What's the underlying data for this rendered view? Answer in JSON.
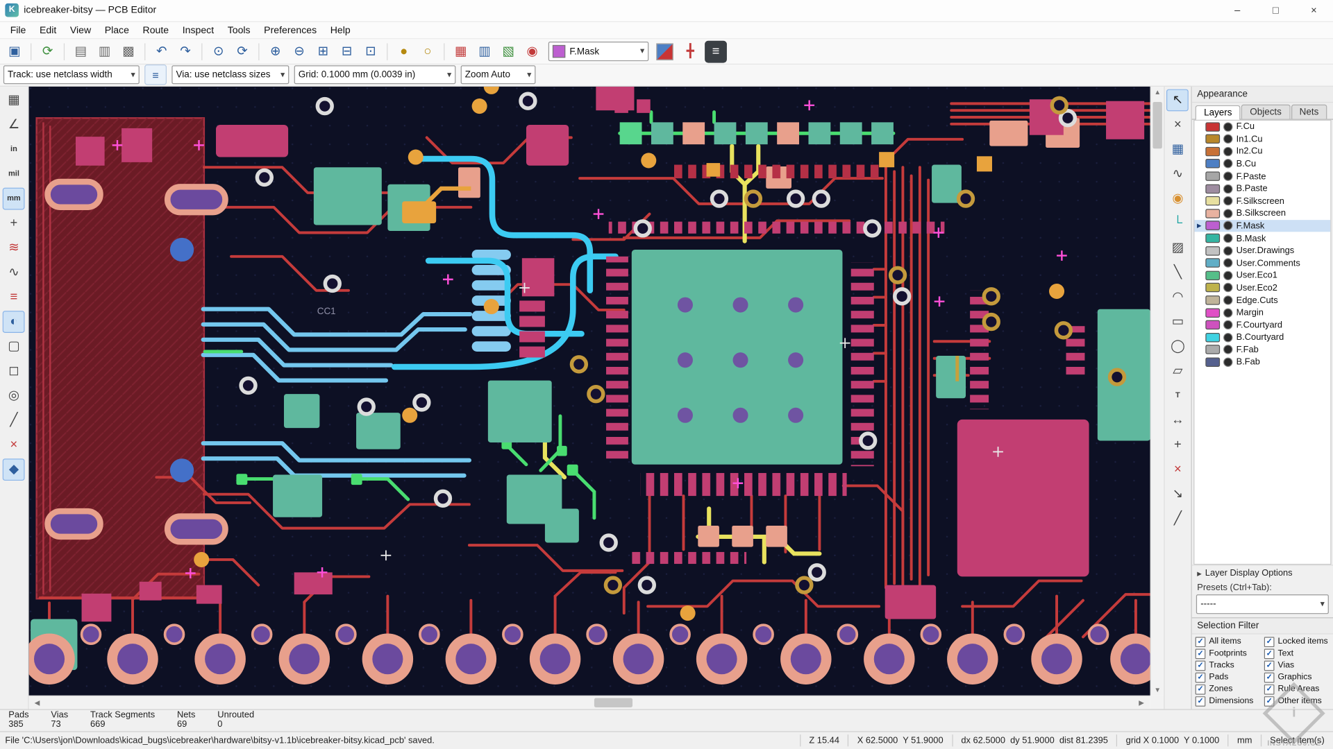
{
  "window": {
    "title": "icebreaker-bitsy — PCB Editor",
    "controls": [
      "–",
      "□",
      "×"
    ]
  },
  "menu_bar": {
    "items": [
      "File",
      "Edit",
      "View",
      "Place",
      "Route",
      "Inspect",
      "Tools",
      "Preferences",
      "Help"
    ]
  },
  "toolbar_main": {
    "icons": [
      {
        "name": "save-icon",
        "glyph": "▣",
        "color": "#2E5F9E"
      },
      {
        "sep": true
      },
      {
        "name": "plugin-refresh-icon",
        "glyph": "⟳",
        "color": "#3D8F3D"
      },
      {
        "sep": true
      },
      {
        "name": "page-settings-icon",
        "glyph": "▤",
        "color": "#666666"
      },
      {
        "name": "print-icon",
        "glyph": "▥",
        "color": "#666666"
      },
      {
        "name": "plot-icon",
        "glyph": "▩",
        "color": "#666666"
      },
      {
        "sep": true
      },
      {
        "name": "undo-icon",
        "glyph": "↶",
        "color": "#2E5F9E"
      },
      {
        "name": "redo-icon",
        "glyph": "↷",
        "color": "#2E5F9E"
      },
      {
        "sep": true
      },
      {
        "name": "find-icon",
        "glyph": "⊙",
        "color": "#2E5F9E"
      },
      {
        "name": "refresh-view-icon",
        "glyph": "⟳",
        "color": "#2E5F9E"
      },
      {
        "sep": true
      },
      {
        "name": "zoom-in-icon",
        "glyph": "⊕",
        "color": "#2E5F9E"
      },
      {
        "name": "zoom-out-icon",
        "glyph": "⊖",
        "color": "#2E5F9E"
      },
      {
        "name": "zoom-fit-icon",
        "glyph": "⊞",
        "color": "#2E5F9E"
      },
      {
        "name": "zoom-fit-objects-icon",
        "glyph": "⊟",
        "color": "#2E5F9E"
      },
      {
        "name": "zoom-selection-icon",
        "glyph": "⊡",
        "color": "#2E5F9E"
      },
      {
        "sep": true
      },
      {
        "name": "lock-icon",
        "glyph": "●",
        "color": "#B5890F"
      },
      {
        "name": "unlock-icon",
        "glyph": "○",
        "color": "#B5890F"
      },
      {
        "sep": true
      },
      {
        "name": "drc-pads-icon",
        "glyph": "▦",
        "color": "#C23A3A"
      },
      {
        "name": "footprint-check-icon",
        "glyph": "▥",
        "color": "#2E5F9E"
      },
      {
        "name": "length-tuning-icon",
        "glyph": "▧",
        "color": "#3D8F3D"
      },
      {
        "name": "drc-check-icon",
        "glyph": "◉",
        "color": "#C23A3A"
      }
    ],
    "layer_selector": {
      "value": "F.Mask",
      "swatch_color": "#BD5FD0"
    },
    "icons_after": [
      {
        "name": "layer-pair-swatch-icon",
        "glyph": "",
        "diag": true
      },
      {
        "name": "highlight-net-icon",
        "glyph": "╋",
        "color": "#C23A3A"
      },
      {
        "name": "net-inspector-icon",
        "glyph": "≡",
        "color": "#FFFFFF",
        "bg": "#3A3F44"
      }
    ]
  },
  "toolbar_sizes": {
    "track": "Track: use netclass width",
    "edit_icon": "≡",
    "via": "Via: use netclass sizes",
    "grid": "Grid: 0.1000 mm (0.0039 in)",
    "zoom": "Zoom Auto"
  },
  "left_toolbar": {
    "icons": [
      {
        "name": "grid-toggle-icon",
        "glyph": "▦",
        "color": "#444444"
      },
      {
        "name": "polar-coords-icon",
        "glyph": "∠",
        "color": "#444444"
      },
      {
        "name": "units-inches-icon",
        "glyph": "in",
        "text": true
      },
      {
        "name": "units-mils-icon",
        "glyph": "mil",
        "text": true
      },
      {
        "name": "units-mm-icon",
        "glyph": "mm",
        "text": true,
        "active": true
      },
      {
        "name": "crosshair-style-icon",
        "glyph": "+",
        "color": "#444444"
      },
      {
        "name": "ratsnest-hide-icon",
        "glyph": "≋",
        "color": "#C23A3A"
      },
      {
        "name": "ratsnest-curved-icon",
        "glyph": "∿",
        "color": "#444444"
      },
      {
        "name": "net-color-mode-icon",
        "glyph": "≡",
        "color": "#C23A3A"
      },
      {
        "name": "high-contrast-mode-icon",
        "glyph": "◐",
        "color": "#2E5F9E",
        "active": true
      },
      {
        "name": "zone-outline-mode-icon",
        "glyph": "▢",
        "color": "#444444"
      },
      {
        "name": "pad-display-mode-icon",
        "glyph": "◻",
        "color": "#444444"
      },
      {
        "name": "via-display-mode-icon",
        "glyph": "◎",
        "color": "#444444"
      },
      {
        "name": "track-display-mode-icon",
        "glyph": "╱",
        "color": "#444444"
      },
      {
        "name": "drc-disable-icon",
        "glyph": "×",
        "color": "#C23A3A"
      },
      {
        "name": "layers-manager-toggle-icon",
        "glyph": "◆",
        "color": "#2E5F9E",
        "active": true
      }
    ]
  },
  "right_toolbar": {
    "icons": [
      {
        "name": "select-tool-icon",
        "glyph": "↖",
        "color": "#222222",
        "active": true
      },
      {
        "name": "net-highlight-tool-icon",
        "glyph": "×",
        "color": "#444444"
      },
      {
        "name": "ratsnest-local-icon",
        "glyph": "▦",
        "color": "#2E5F9E"
      },
      {
        "name": "tune-length-icon",
        "glyph": "∿",
        "color": "#444444"
      },
      {
        "name": "via-tool-icon",
        "glyph": "◉",
        "color": "#D89030"
      },
      {
        "name": "route-track-icon",
        "glyph": "└",
        "color": "#18A2A0"
      },
      {
        "name": "zone-tool-icon",
        "glyph": "▨",
        "color": "#444444"
      },
      {
        "name": "line-tool-icon",
        "glyph": "╲",
        "color": "#444444"
      },
      {
        "name": "arc-tool-icon",
        "glyph": "◠",
        "color": "#444444"
      },
      {
        "name": "rect-tool-icon",
        "glyph": "▭",
        "color": "#444444"
      },
      {
        "name": "circle-tool-icon",
        "glyph": "◯",
        "color": "#444444"
      },
      {
        "name": "polygon-tool-icon",
        "glyph": "▱",
        "color": "#444444"
      },
      {
        "name": "text-tool-icon",
        "glyph": "T",
        "color": "#444444",
        "text": true
      },
      {
        "name": "dimension-tool-icon",
        "glyph": "↔",
        "color": "#444444"
      },
      {
        "name": "origin-tool-icon",
        "glyph": "+",
        "color": "#444444"
      },
      {
        "name": "delete-tool-icon",
        "glyph": "×",
        "color": "#C23A3A"
      },
      {
        "name": "export-tool-icon",
        "glyph": "↘",
        "color": "#444444"
      },
      {
        "name": "measure-tool-icon",
        "glyph": "╱",
        "color": "#444444"
      }
    ]
  },
  "canvas": {
    "labels": {
      "cc1": "CC1"
    }
  },
  "appearance": {
    "title": "Appearance",
    "tabs": [
      {
        "label": "Layers"
      },
      {
        "label": "Objects"
      },
      {
        "label": "Nets"
      }
    ],
    "layers": [
      {
        "name": "F.Cu",
        "color": "#C83434"
      },
      {
        "name": "In1.Cu",
        "color": "#B8872B"
      },
      {
        "name": "In2.Cu",
        "color": "#C87137"
      },
      {
        "name": "B.Cu",
        "color": "#4D7FC4"
      },
      {
        "name": "F.Paste",
        "color": "#A6A6A6"
      },
      {
        "name": "B.Paste",
        "color": "#9E8CA0"
      },
      {
        "name": "F.Silkscreen",
        "color": "#E8E0A0"
      },
      {
        "name": "B.Silkscreen",
        "color": "#E8B2A0"
      },
      {
        "name": "F.Mask",
        "color": "#BD5FD0",
        "selected": true
      },
      {
        "name": "B.Mask",
        "color": "#35B5A2"
      },
      {
        "name": "User.Drawings",
        "color": "#C2C2C2"
      },
      {
        "name": "User.Comments",
        "color": "#61AEC6"
      },
      {
        "name": "User.Eco1",
        "color": "#55BE89"
      },
      {
        "name": "User.Eco2",
        "color": "#BEB24B"
      },
      {
        "name": "Edge.Cuts",
        "color": "#C0B49A"
      },
      {
        "name": "Margin",
        "color": "#E04FC6"
      },
      {
        "name": "F.Courtyard",
        "color": "#CE52BE"
      },
      {
        "name": "B.Courtyard",
        "color": "#3FD2E2"
      },
      {
        "name": "F.Fab",
        "color": "#ABABAB"
      },
      {
        "name": "B.Fab",
        "color": "#55608E"
      }
    ],
    "layer_display_options": "Layer Display Options",
    "presets_label": "Presets (Ctrl+Tab):",
    "presets_value": "-----"
  },
  "selection_filter": {
    "title": "Selection Filter",
    "all_checked": true,
    "columns": [
      [
        "All items",
        "Footprints",
        "Tracks",
        "Pads",
        "Zones",
        "Dimensions"
      ],
      [
        "Locked items",
        "Text",
        "Vias",
        "Graphics",
        "Rule Areas",
        "Other items"
      ]
    ]
  },
  "status_counts": [
    {
      "label": "Pads",
      "value": "385"
    },
    {
      "label": "Vias",
      "value": "73"
    },
    {
      "label": "Track Segments",
      "value": "669"
    },
    {
      "label": "Nets",
      "value": "69"
    },
    {
      "label": "Unrouted",
      "value": "0"
    }
  ],
  "status_bar": {
    "message": "File 'C:\\Users\\jon\\Downloads\\kicad_bugs\\icebreaker\\hardware\\bitsy-v1.1b\\icebreaker-bitsy.kicad_pcb' saved.",
    "zoom": "Z 15.44",
    "position": "X 62.5000  Y 51.9000",
    "delta": "dx 62.5000  dy 51.9000  dist 81.2395",
    "grid": "grid X 0.1000  Y 0.1000",
    "units": "mm",
    "mode": "Select item(s)"
  },
  "watermark": "INSTALUJ.CZ"
}
